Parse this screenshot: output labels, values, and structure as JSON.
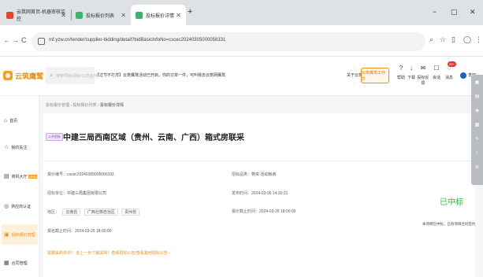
{
  "browser": {
    "tabs": [
      {
        "title": "云筑网首页-机器审核监控",
        "active": false
      },
      {
        "title": "投标报价列表",
        "active": false
      },
      {
        "title": "投标报价详情",
        "active": true
      }
    ],
    "new_tab": "+",
    "window_controls": {
      "minimize": "−",
      "restore": "▢",
      "close": "✕"
    },
    "nav": {
      "back": "←",
      "forward": "→",
      "reload": "C"
    },
    "url": "mf.yzw.cn/tender/supplier-bidding/detail?bidBasicInfoNo=cscec20240305000056331"
  },
  "header": {
    "logo_text": "云筑鹰鹫",
    "search_placeholder": "搜索项目/招标/公司名称",
    "notice": "【过节不打烊】云筑鹰鹫活动已开启，你的订单一件，可叫我去云筑网鹰鹫",
    "link": "关于云筑",
    "workbench_button": "云筑鹰鹫工作台",
    "icons": [
      {
        "label": "帮助",
        "glyph": "?"
      },
      {
        "label": "下载",
        "glyph": "↓"
      },
      {
        "label": "投标反馈",
        "glyph": "✉"
      },
      {
        "label": "会话",
        "glyph": "☐"
      },
      {
        "label": "消息",
        "glyph": "♢"
      }
    ],
    "message_badge": "99+",
    "username": "李四"
  },
  "sidebar": {
    "items": [
      {
        "label": "首页",
        "glyph": "⌂",
        "active": false
      },
      {
        "label": "我的关注",
        "glyph": "☆",
        "active": false
      },
      {
        "label": "商机大厅",
        "glyph": "▤",
        "active": false,
        "tag": "NEW"
      },
      {
        "label": "供应商认证",
        "glyph": "◎",
        "active": false
      },
      {
        "label": "投标报价管理",
        "glyph": "▣",
        "active": true
      },
      {
        "label": "合同管理",
        "glyph": "▦",
        "active": false
      }
    ]
  },
  "breadcrumb": [
    "投标报价管理",
    "投标报价列表",
    "投标报价详情"
  ],
  "detail": {
    "type_tag": "公开招标",
    "title": "中建三局西南区域（贵州、云南、广西）箱式房联采",
    "fields": {
      "bid_no_label": "报价编号：",
      "bid_no": "cscec20240305000056331",
      "company_label": "招标单位：",
      "company": "中建三局集团有限公司",
      "region_label": "地区：",
      "regions": [
        "云南省",
        "广西壮族自治区",
        "贵州省"
      ],
      "deadline_label": "报名截止时间：",
      "deadline": "2024-03-25 18:00:00",
      "category_label": "招标品类：",
      "category": "物资-活动板房",
      "publish_label": "发布时间：",
      "publish": "2024-03-06 14:30:21",
      "quote_end_label": "报价截止时间：",
      "quote_end": "2024-03-25 18:00:00"
    },
    "status": "已中标",
    "status_note": "本项目已中标，已有项目合同签约",
    "footer_link": "需要采购资讯？ 去上一步了解采购！查看招标公告/查看其他招标公告 ›"
  },
  "colors": {
    "accent": "#f28d11",
    "success": "#2ebd3a",
    "tag_purple": "#8b3ec7"
  }
}
